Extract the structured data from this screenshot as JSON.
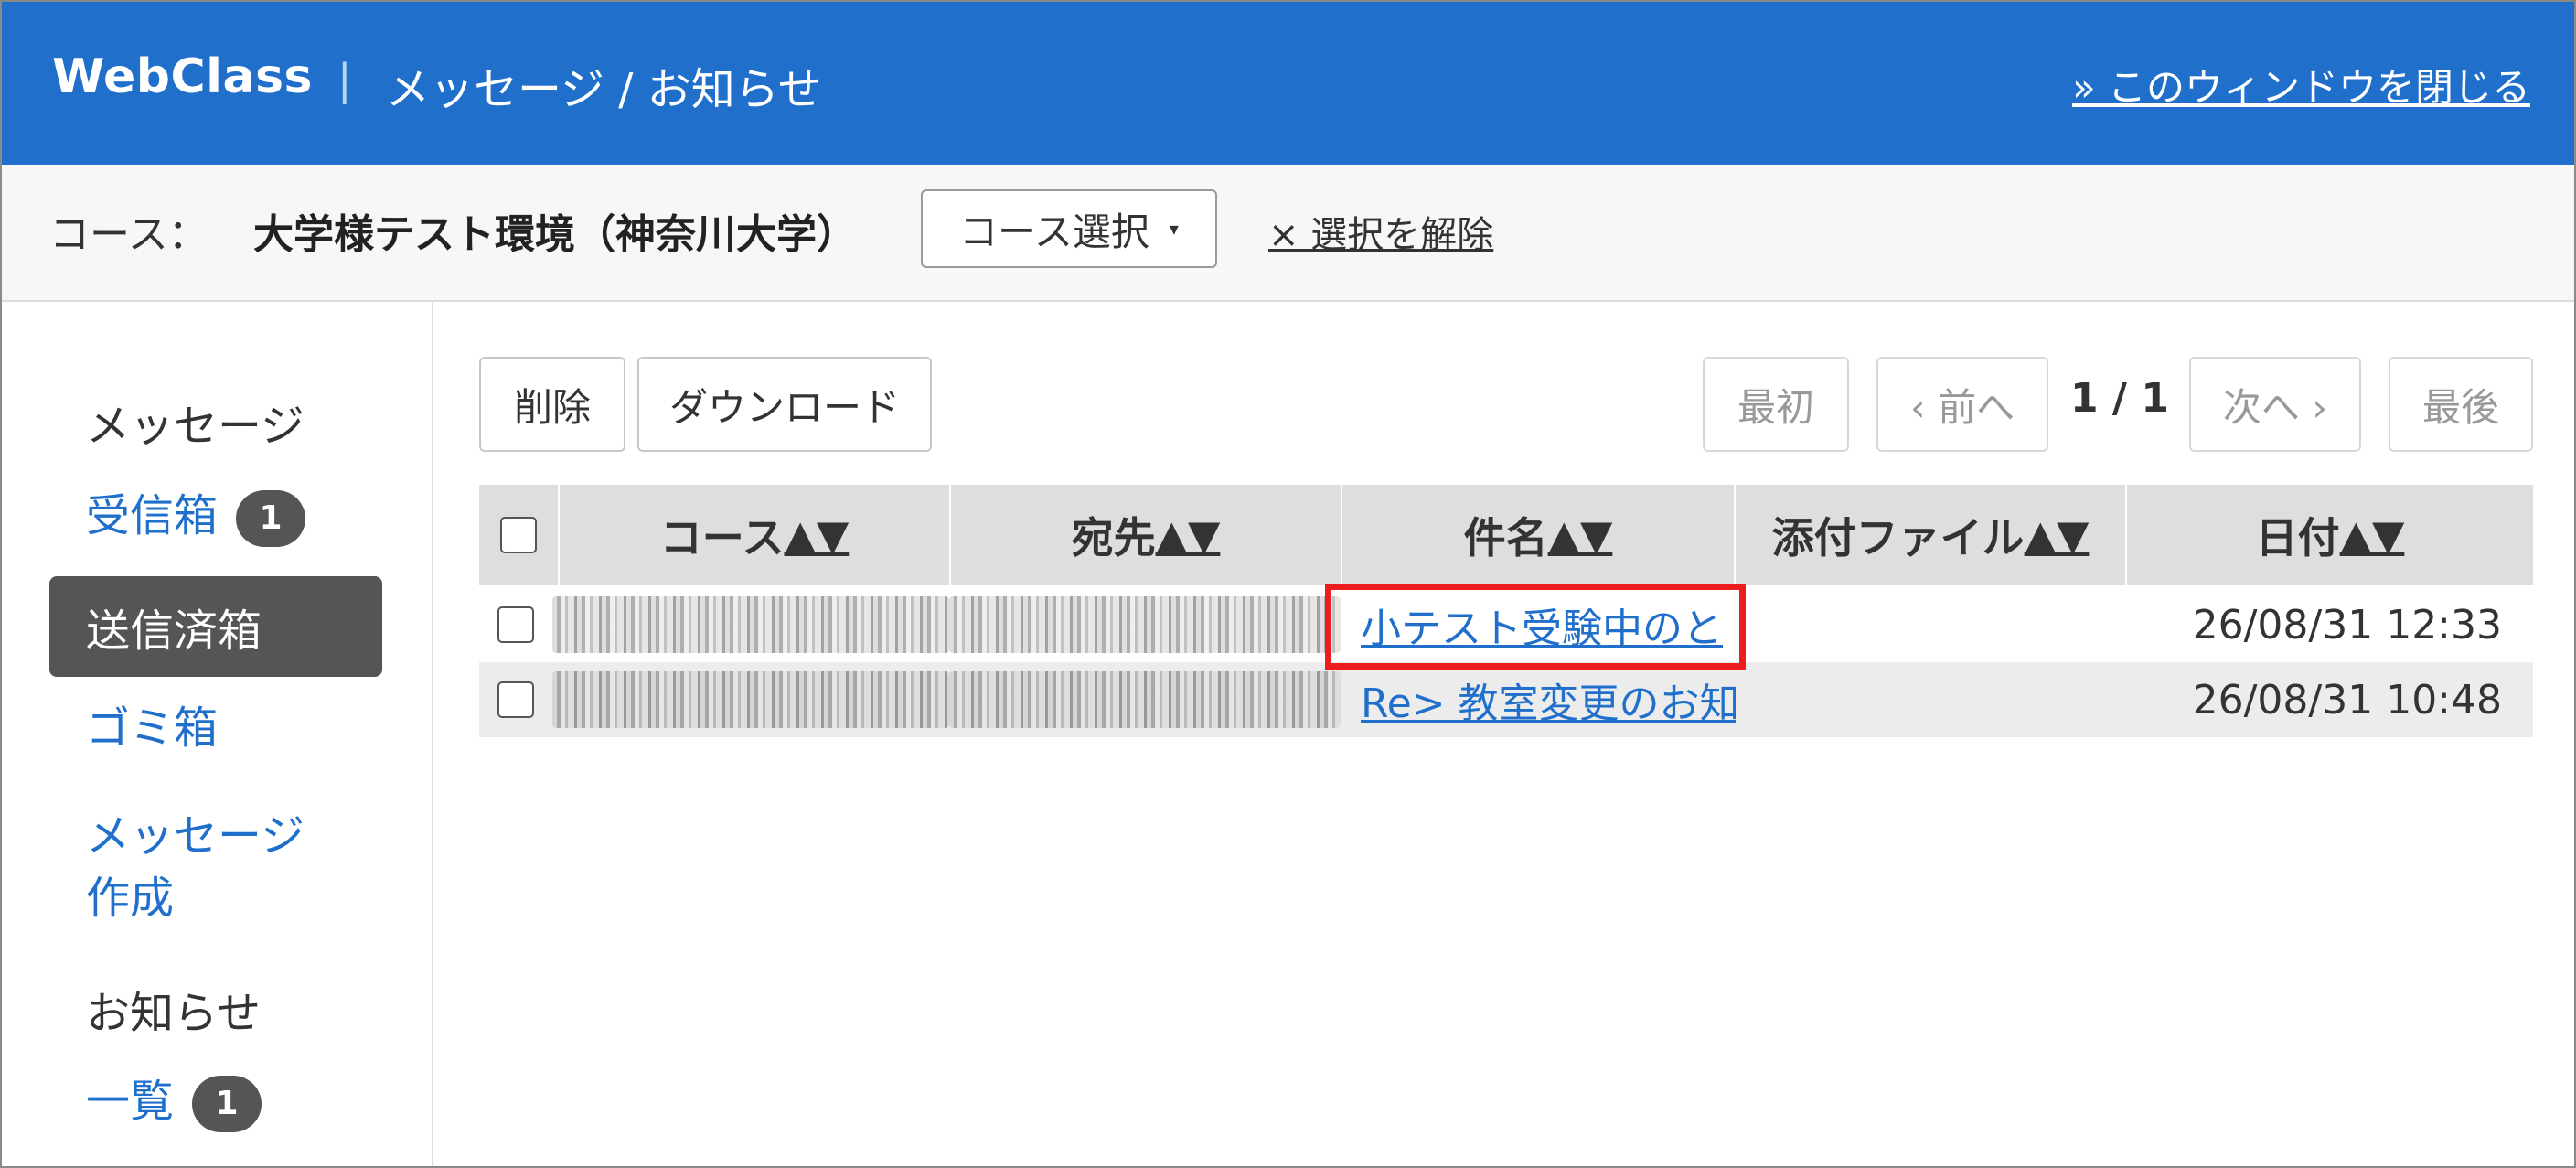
{
  "header": {
    "brand": "WebClass",
    "separator": "|",
    "title": "メッセージ / お知らせ",
    "close_link": "» このウィンドウを閉じる"
  },
  "course_bar": {
    "label": "コース：",
    "course_name": "大学様テスト環境（神奈川大学）",
    "select_button": "コース選択",
    "select_caret": "▾",
    "clear_link": "× 選択を解除"
  },
  "sidebar": {
    "message_heading": "メッセージ",
    "inbox": "受信箱",
    "inbox_badge": "1",
    "sent": "送信済箱",
    "trash": "ゴミ箱",
    "compose_line1": "メッセージ",
    "compose_line2": "作成",
    "notice_heading": "お知らせ",
    "notice_list": "一覧",
    "notice_badge": "1"
  },
  "toolbar": {
    "delete": "削除",
    "download": "ダウンロード",
    "first": "最初",
    "prev": "‹ 前へ",
    "page": "1 / 1",
    "next": "次へ ›",
    "last": "最後"
  },
  "table": {
    "headers": [
      {
        "label": "コース",
        "sort": "▲▼"
      },
      {
        "label": "宛先",
        "sort": "▲▼"
      },
      {
        "label": "件名",
        "sort": "▲▼"
      },
      {
        "label": "添付ファイル",
        "sort": "▲▼"
      },
      {
        "label": "日付",
        "sort": "▲▼"
      }
    ],
    "rows": [
      {
        "subject": "小テスト受験中のと",
        "attachment": "",
        "date": "26/08/31 12:33"
      },
      {
        "subject": "Re> 教室変更のお知",
        "attachment": "",
        "date": "26/08/31 10:48"
      }
    ]
  },
  "colors": {
    "header_bg": "#1f6fcb",
    "link": "#1f6fcb",
    "active_nav_bg": "#555555",
    "highlight_border": "#ee1c1c"
  }
}
